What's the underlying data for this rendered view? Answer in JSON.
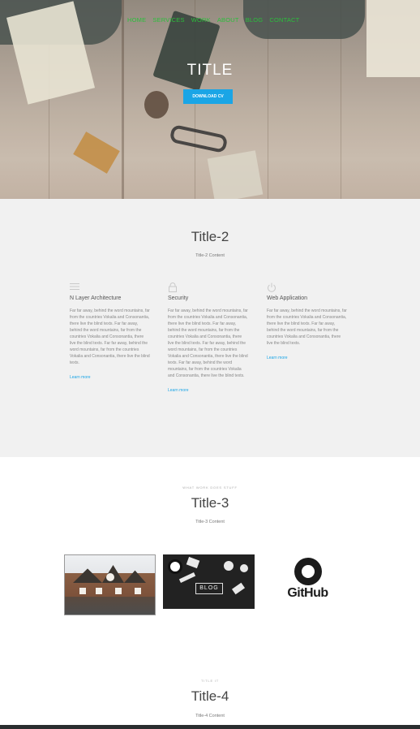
{
  "nav": {
    "items": [
      "HOME",
      "SERVICES",
      "WORK",
      "ABOUT",
      "BLOG",
      "CONTACT"
    ]
  },
  "hero": {
    "title": "TITLE",
    "button_label": "DOWNLOAD CV"
  },
  "section2": {
    "title": "Title-2",
    "subtitle": "Title-2 Content",
    "features": [
      {
        "icon": "menu-icon",
        "title": "N Layer Architecture",
        "text": "Far far away, behind the word mountains, far from the countries Vokalia and Consonantia, there live the blind texts. Far far away, behind the word mountains, far from the countries Vokalia and Consonantia, there live the blind texts. Far far away, behind the word mountains, far from the countries Vokalia and Consonantia, there live the blind texts.",
        "link": "Learn more"
      },
      {
        "icon": "lock-icon",
        "title": "Security",
        "text": "Far far away, behind the word mountains, far from the countries Vokalia and Consonantia, there live the blind texts. Far far away, behind the word mountains, far from the countries Vokalia and Consonantia, there live the blind texts. Far far away, behind the word mountains, far from the countries Vokalia and Consonantia, there live the blind texts. Far far away, behind the word mountains, far from the countries Vokalia and Consonantia, there live the blind texts.",
        "link": "Learn more"
      },
      {
        "icon": "power-icon",
        "title": "Web Application",
        "text": "Far far away, behind the word mountains, far from the countries Vokalia and Consonantia, there live the blind texts. Far far away, behind the word mountains, far from the countries Vokalia and Consonantia, there live the blind texts.",
        "link": "Learn more"
      }
    ]
  },
  "section3": {
    "eyebrow": "WHAT WORK DOES STUFF",
    "title": "Title-3",
    "subtitle": "Title-3 Content",
    "thumbnails": [
      "house-photo",
      "blog-photo",
      "github-logo"
    ],
    "github_word": "GitHub",
    "blog_word": "BLOG"
  },
  "section4": {
    "eyebrow": "TITLE IT",
    "title": "Title-4",
    "subtitle": "Title-4 Content"
  },
  "colors": {
    "accent": "#1aa5e6",
    "nav_green": "#2bbf3b",
    "section_gray": "#f1f1f1",
    "footer": "#2a2d2f"
  }
}
